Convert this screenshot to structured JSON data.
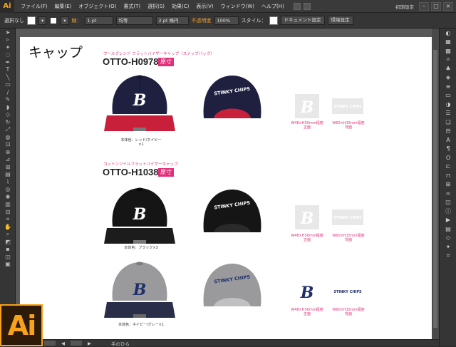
{
  "app": {
    "logo": "Ai",
    "big_logo": "Ai"
  },
  "menu": [
    "ファイル(F)",
    "編集(E)",
    "オブジェクト(O)",
    "書式(T)",
    "選択(S)",
    "効果(C)",
    "表示(V)",
    "ウィンドウ(W)",
    "ヘルプ(H)"
  ],
  "workspace": "初期設定",
  "window_buttons": [
    "–",
    "□",
    "×"
  ],
  "control": {
    "selection": "選択なし",
    "stroke_label": "線：",
    "stroke_value": "1 pt",
    "stroke_style": "均等",
    "brush": "2 pt 楕円",
    "opacity_label": "不透明度",
    "opacity_value": "100%",
    "style_label": "スタイル：",
    "doc_setup": "ドキュメント設定",
    "prefs": "環境設定"
  },
  "status": {
    "tool": "手のひら"
  },
  "artboard": {
    "title": "キャップ",
    "products": [
      {
        "subtitle": "ウールブレンド フラットバイザーキャップ（スナップバック）",
        "model": "OTTO-H0978",
        "badge": "原寸",
        "caption": "本体色：レッド/ネイビー×1",
        "print_front": "W48×H50mm程度\n正面",
        "print_back": "W60×H15mm程度\n背面"
      },
      {
        "subtitle": "コットンツイルフラットバイザーキャップ",
        "model": "OTTO-H1038",
        "badge": "原寸",
        "caption1": "本体色：ブラック×3",
        "caption2": "本体色：ネイビー/グレー×1",
        "print_front": "W48×H50mm程度\n正面",
        "print_back": "W60×H15mm程度\n背面",
        "print_front2": "W48×H50mm程度\n正面",
        "print_back2": "W60×H15mm程度\n背面"
      }
    ],
    "back_text": "STINKY CHIPS"
  },
  "colors": {
    "accent": "#e0307a",
    "navy": "#1f2040",
    "red": "#c8203a",
    "black": "#151515",
    "grey": "#9a9a9c",
    "ai_orange": "#f7a21b"
  },
  "icons": [
    "selection-icon",
    "direct-selection-icon",
    "magic-wand-icon",
    "lasso-icon",
    "pen-icon",
    "type-icon",
    "line-icon",
    "rectangle-icon",
    "paintbrush-icon",
    "pencil-icon",
    "eraser-icon",
    "rotate-icon",
    "scale-icon",
    "warp-icon",
    "free-transform-icon",
    "shape-builder-icon",
    "perspective-icon",
    "mesh-icon",
    "gradient-icon",
    "eyedropper-icon",
    "blend-icon",
    "symbol-sprayer-icon",
    "graph-icon",
    "artboard-icon",
    "slice-icon",
    "hand-icon",
    "zoom-icon"
  ]
}
